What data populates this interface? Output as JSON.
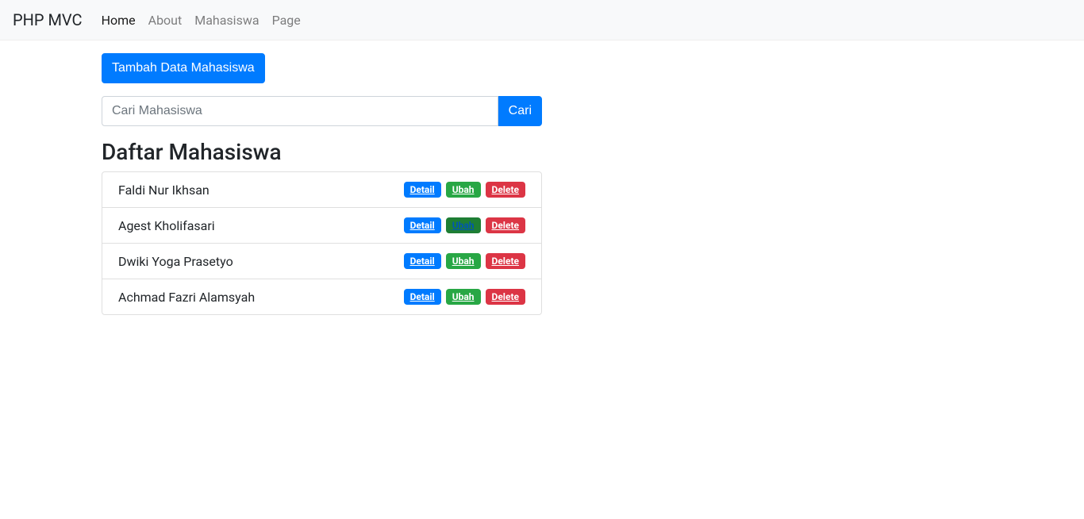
{
  "navbar": {
    "brand": "PHP MVC",
    "links": [
      {
        "label": "Home",
        "active": true
      },
      {
        "label": "About",
        "active": false
      },
      {
        "label": "Mahasiswa",
        "active": false
      },
      {
        "label": "Page",
        "active": false
      }
    ]
  },
  "main": {
    "add_button": "Tambah Data Mahasiswa",
    "search": {
      "placeholder": "Cari Mahasiswa",
      "button": "Cari"
    },
    "list_title": "Daftar Mahasiswa",
    "students": [
      {
        "name": "Faldi Nur Ikhsan",
        "ubah_hover": false
      },
      {
        "name": "Agest Kholifasari",
        "ubah_hover": true
      },
      {
        "name": "Dwiki Yoga Prasetyo",
        "ubah_hover": false
      },
      {
        "name": "Achmad Fazri Alamsyah",
        "ubah_hover": false
      }
    ],
    "actions": {
      "detail": "Detail",
      "ubah": "Ubah",
      "delete": "Delete"
    }
  }
}
